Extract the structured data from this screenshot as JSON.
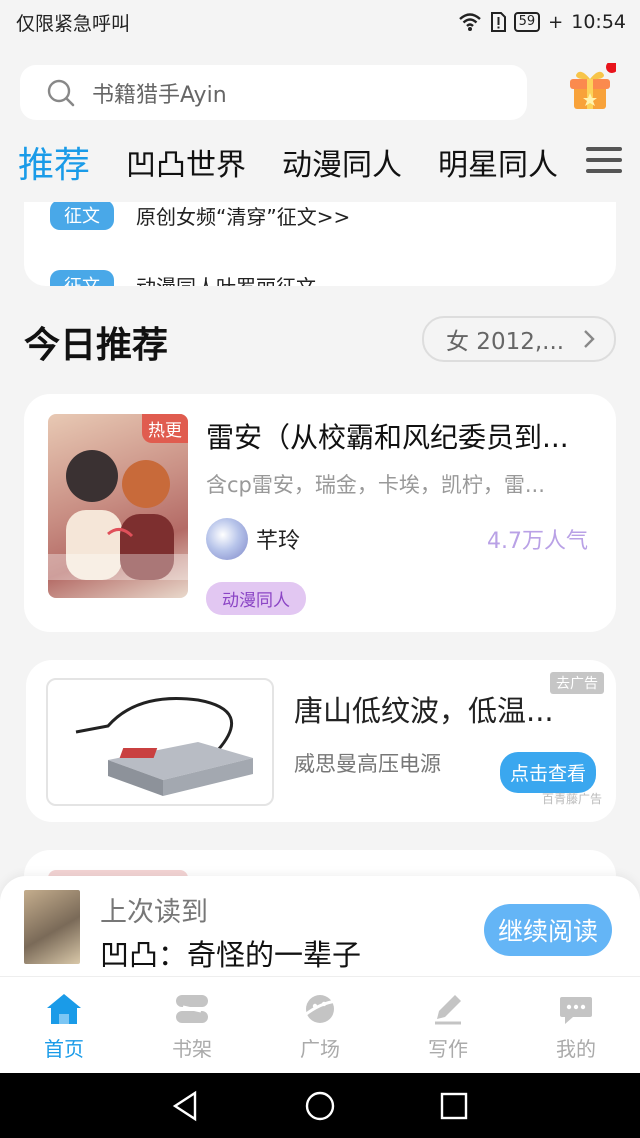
{
  "status_bar": {
    "carrier": "仅限紧急呼叫",
    "battery": "59",
    "time": "10:54"
  },
  "search": {
    "placeholder": "书籍猎手Ayin"
  },
  "tabs": [
    {
      "label": "推荐"
    },
    {
      "label": "凹凸世界"
    },
    {
      "label": "动漫同人"
    },
    {
      "label": "明星同人"
    }
  ],
  "notices": [
    {
      "tag": "征文",
      "text": "原创女频“清穿”征文>>"
    },
    {
      "tag": "征文",
      "text": "动漫同人叶罗丽征文"
    }
  ],
  "recommend": {
    "title": "今日推荐",
    "filter": "女 2012,..."
  },
  "book": {
    "badge": "热更",
    "title": "雷安（从校霸和风纪委员到...",
    "desc": "含cp雷安，瑞金，卡埃，凯柠，雷...",
    "author": "芊玲",
    "popularity": "4.7万人气",
    "genre": "动漫同人"
  },
  "ad": {
    "title": "唐山低纹波，低温...",
    "subtitle": "威思曼高压电源",
    "close_label": "去广告",
    "cta": "点击查看",
    "source": "百青藤广告"
  },
  "last_read": {
    "label": "上次读到",
    "title": "凹凸：奇怪的一辈子",
    "button": "继续阅读"
  },
  "bottom_nav": [
    {
      "label": "首页",
      "icon": "home-icon"
    },
    {
      "label": "书架",
      "icon": "bookshelf-icon"
    },
    {
      "label": "广场",
      "icon": "planet-icon"
    },
    {
      "label": "写作",
      "icon": "pen-icon"
    },
    {
      "label": "我的",
      "icon": "chat-bubble-icon"
    }
  ],
  "colors": {
    "accent": "#1a9be8",
    "hot_badge": "#e05c4f",
    "genre_tag": "#e2c7f2",
    "popularity": "#b9a1e6"
  }
}
